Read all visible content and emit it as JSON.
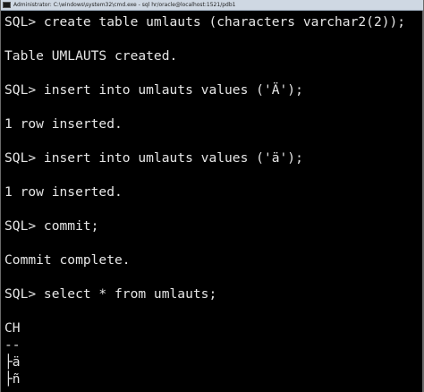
{
  "window": {
    "title": "Administrator: C:\\windows\\system32\\cmd.exe - sql  hr/oracle@localhost:1521/pdb1"
  },
  "console": {
    "lines": [
      "SQL> create table umlauts (characters varchar2(2));",
      "Table UMLAUTS created.",
      "SQL> insert into umlauts values ('Ä');",
      "1 row inserted.",
      "SQL> insert into umlauts values ('ä');",
      "1 row inserted.",
      "SQL> commit;",
      "Commit complete.",
      "SQL> select * from umlauts;",
      "CH",
      "--",
      "├ä",
      "├ñ"
    ]
  }
}
